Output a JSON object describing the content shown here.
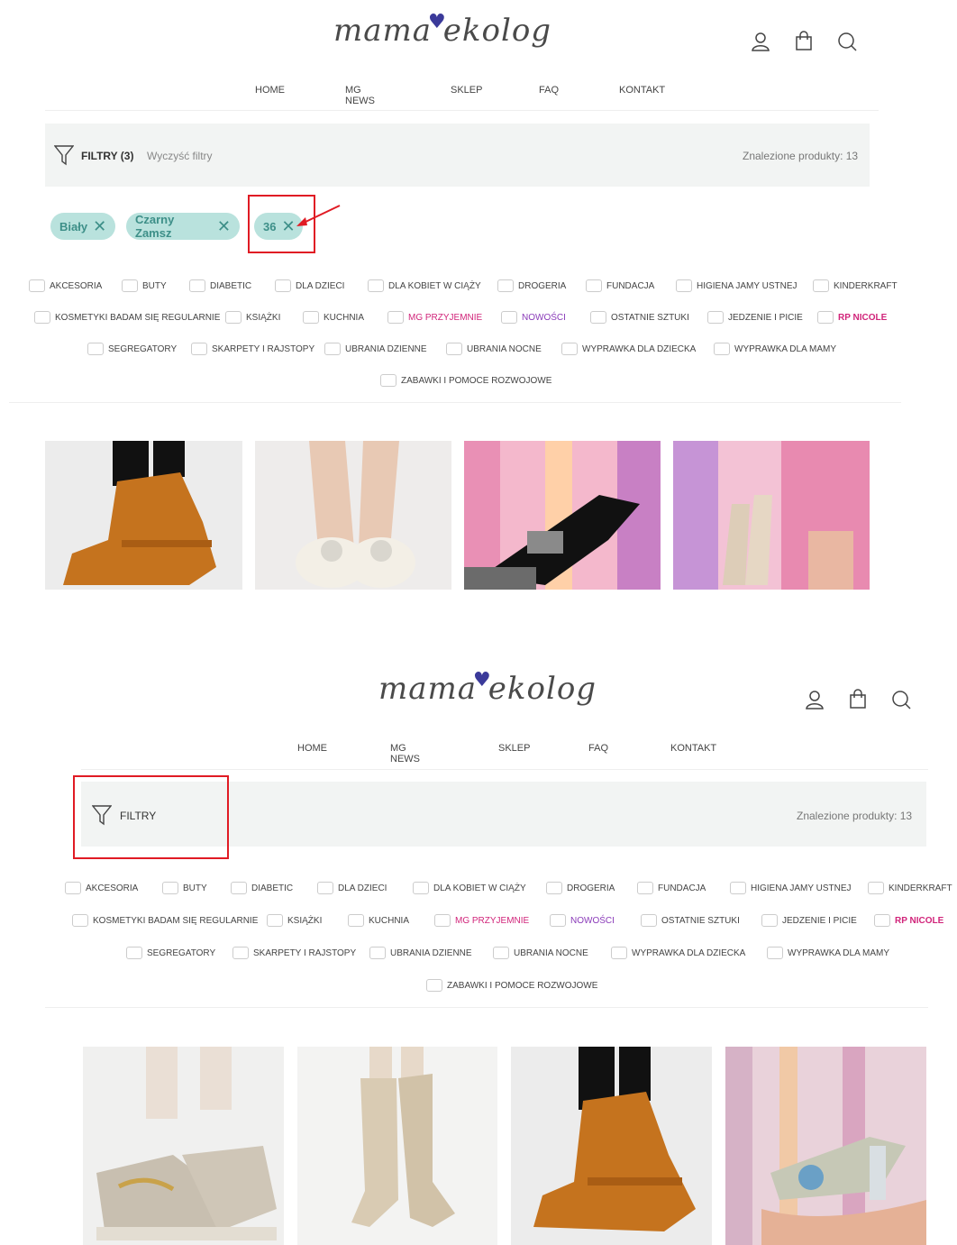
{
  "brand": {
    "logo_text_left": "mama",
    "logo_text_right": "ekolog"
  },
  "nav": [
    "HOME",
    "MG NEWS",
    "SKLEP",
    "FAQ",
    "KONTAKT"
  ],
  "icons": [
    "user-icon",
    "bag-icon",
    "search-icon"
  ],
  "panel1": {
    "filter_label": "FILTRY (3)",
    "clear_label": "Wyczyść filtry",
    "found_label": "Znalezione produkty:",
    "found_count": "13",
    "chips": [
      "Biały",
      "Czarny Zamsz",
      "36"
    ]
  },
  "panel2": {
    "filter_label": "FILTRY",
    "found_label": "Znalezione produkty:",
    "found_count": "13"
  },
  "categories": {
    "row1": [
      "AKCESORIA",
      "BUTY",
      "DIABETIC",
      "DLA DZIECI",
      "DLA KOBIET W CIĄŻY",
      "DROGERIA",
      "FUNDACJA",
      "HIGIENA JAMY USTNEJ",
      "KINDERKRAFT"
    ],
    "row2": [
      "KOSMETYKI BADAM SIĘ REGULARNIE",
      "KSIĄŻKI",
      "KUCHNIA",
      "MG PRZYJEMNIE",
      "NOWOŚCI",
      "OSTATNIE SZTUKI",
      "JEDZENIE I PICIE",
      "RP NICOLE"
    ],
    "row3": [
      "SEGREGATORY",
      "SKARPETY I RAJSTOPY",
      "UBRANIA DZIENNE",
      "UBRANIA NOCNE",
      "WYPRAWKA DLA DZIECKA",
      "WYPRAWKA DLA MAMY"
    ],
    "row4": [
      "ZABAWKI I POMOCE ROZWOJOWE"
    ]
  },
  "colors": {
    "chip_bg": "#b9e2dd",
    "chip_text": "#3d8f88",
    "highlight": "#e01b24",
    "pink": "#d1247a",
    "purple": "#8a3ab9"
  }
}
